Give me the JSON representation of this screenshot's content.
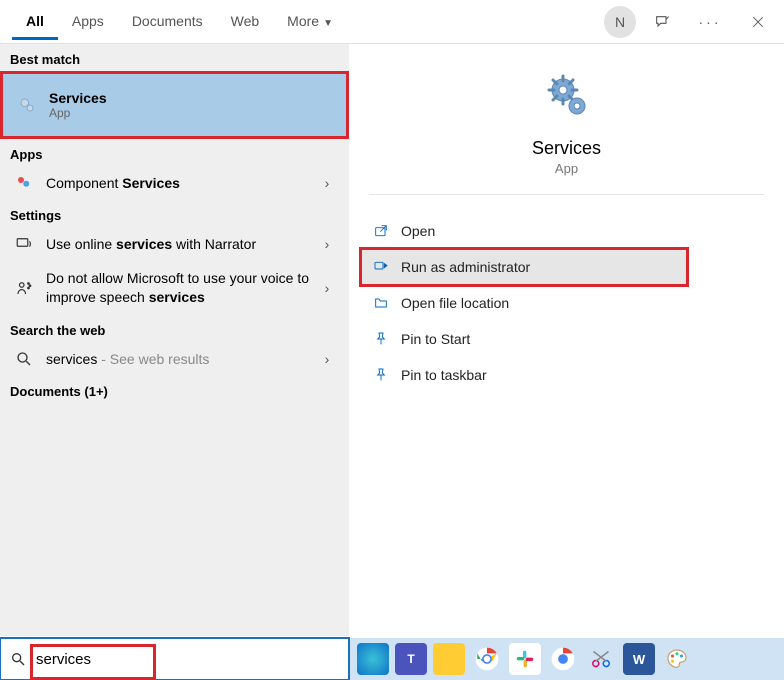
{
  "tabs": [
    "All",
    "Apps",
    "Documents",
    "Web",
    "More"
  ],
  "active_tab": "All",
  "avatar_letter": "N",
  "left": {
    "best_match_label": "Best match",
    "best_match": {
      "title": "Services",
      "subtitle": "App"
    },
    "apps_label": "Apps",
    "apps": [
      {
        "title_pre": "Component ",
        "title_bold": "Services"
      }
    ],
    "settings_label": "Settings",
    "settings": [
      {
        "title_pre": "Use online ",
        "title_bold": "services",
        "title_post": " with Narrator"
      },
      {
        "title_pre": "Do not allow Microsoft to use your voice to improve speech ",
        "title_bold": "services",
        "title_post": ""
      }
    ],
    "web_label": "Search the web",
    "web": {
      "query": "services",
      "hint": " - See web results"
    },
    "documents_label": "Documents (1+)"
  },
  "preview": {
    "title": "Services",
    "subtitle": "App",
    "actions": [
      "Open",
      "Run as administrator",
      "Open file location",
      "Pin to Start",
      "Pin to taskbar"
    ],
    "highlight_index": 1
  },
  "search_value": "services",
  "tray_icons": [
    "edge",
    "teams",
    "explorer",
    "chrome",
    "slack",
    "chrome2",
    "snip",
    "word",
    "paint"
  ]
}
